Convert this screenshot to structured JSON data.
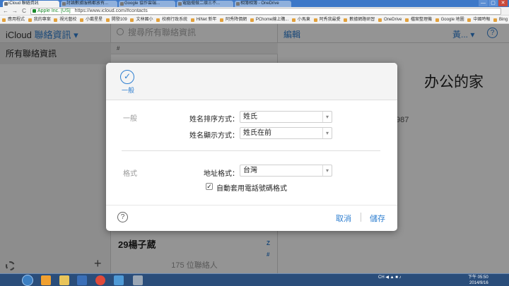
{
  "browser": {
    "tabs": [
      {
        "label": "iCloud 聯絡資訊",
        "active": true
      },
      {
        "label": "討論數據服務都放有...",
        "active": false
      },
      {
        "label": "Google 協作雲端...",
        "active": false
      },
      {
        "label": "電腦擺做二環三不...",
        "active": false
      },
      {
        "label": "相簿相簿 - OneDrive",
        "active": false
      }
    ],
    "window_buttons": [
      "—",
      "▢",
      "✕"
    ],
    "nav": {
      "back": "←",
      "forward": "→",
      "reload": "C"
    },
    "address": {
      "ev_label": "Apple Inc. [US]",
      "url": "https://www.icloud.com/#contacts"
    },
    "bookmarks": [
      "應用程式",
      "我的專案",
      "視光藝校",
      "小戴星星",
      "開發109",
      "文林國小",
      "校務行政系統",
      "HiNet 新年",
      "阿秀降價網",
      "PChome線上購...",
      "小馬東",
      "阿秀我最愛",
      "數據網路研習",
      "OneDrive",
      "檔案整理機",
      "Google 地圖",
      "中國時報",
      "Bing 翻譯"
    ]
  },
  "app": {
    "brand": "iCloud",
    "section": "聯絡資訊 ▾",
    "search_placeholder": "搜尋所有聯絡資訊",
    "edit_label": "編輯",
    "language_label": "黃... ▾",
    "help_label": "?",
    "group_all": "所有聯絡資訊",
    "list_header": "#",
    "name_fragment": "办公的家",
    "phone_fragment": "987",
    "last_contact": "29楊子葳",
    "index_letters": [
      "Z",
      "#"
    ],
    "contact_count": "175 位聯絡人",
    "add_label": "+"
  },
  "dialog": {
    "tab_icon": "✓",
    "tab_label": "一般",
    "general_section": "一般",
    "sort_order_label": "姓名排序方式：",
    "sort_order_value": "姓氏",
    "display_order_label": "姓名顯示方式：",
    "display_order_value": "姓氏在前",
    "format_section": "格式",
    "address_format_label": "地址格式：",
    "address_format_value": "台灣",
    "auto_phone_label": "自動套用電話號碼格式",
    "auto_phone_checked": true,
    "help_label": "?",
    "cancel_label": "取消",
    "save_label": "儲存"
  },
  "taskbar": {
    "tray_text": "CH ◀ ▲ ■ ♪",
    "time": "下午 05:50",
    "date": "2014/9/16"
  },
  "colors": {
    "accent": "#2f7fd0",
    "overlay": "rgba(0,0,0,0.42)",
    "taskbar": "#2a4d7a"
  }
}
